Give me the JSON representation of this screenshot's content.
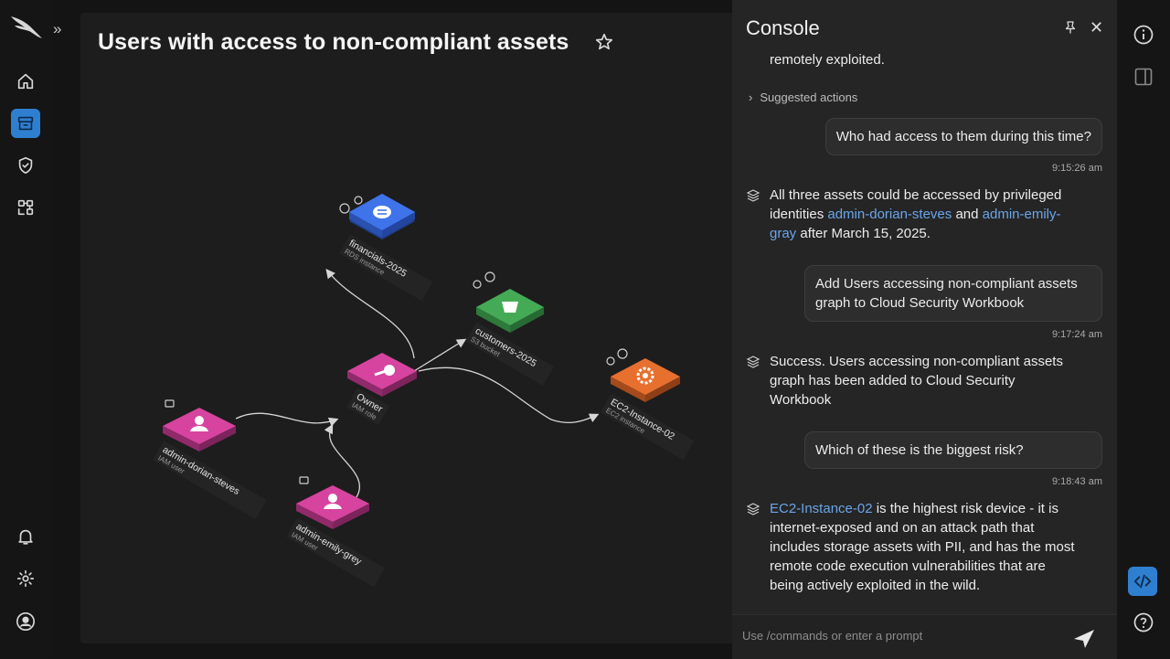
{
  "app": {
    "name": "CrowdStrike Falcon"
  },
  "colors": {
    "accent": "#2f7fd1",
    "link": "#6aa5ea",
    "node_blue": "#3a6be0",
    "node_green": "#3fa14e",
    "node_orange": "#e46a2a",
    "node_pink": "#d03e9b"
  },
  "left_rail": {
    "items": [
      {
        "icon": "home-icon"
      },
      {
        "icon": "archive-box-icon",
        "active": true
      },
      {
        "icon": "shield-check-icon"
      },
      {
        "icon": "connected-graph-icon"
      },
      {
        "icon": "bell-icon"
      },
      {
        "icon": "gear-icon"
      },
      {
        "icon": "user-avatar-icon"
      }
    ]
  },
  "page": {
    "title": "Users with access to non-compliant assets"
  },
  "graph": {
    "nodes": [
      {
        "id": "financials",
        "name": "financials-2025",
        "type": "RDS instance",
        "color": "#3a6be0"
      },
      {
        "id": "customers",
        "name": "customers-2025",
        "type": "S3 bucket",
        "color": "#3fa14e"
      },
      {
        "id": "ec2",
        "name": "EC2-Instance-02",
        "type": "EC2 instance",
        "color": "#e46a2a"
      },
      {
        "id": "owner",
        "name": "Owner",
        "type": "IAM role",
        "color": "#d03e9b"
      },
      {
        "id": "dorian",
        "name": "admin-dorian-steves",
        "type": "IAM user",
        "color": "#d03e9b"
      },
      {
        "id": "emily",
        "name": "admin-emily-grey",
        "type": "IAM user",
        "color": "#d03e9b"
      }
    ]
  },
  "console": {
    "title": "Console",
    "messages": [
      {
        "role": "assistant",
        "text": "remotely exploited."
      },
      {
        "role": "ui",
        "text": "Suggested actions"
      },
      {
        "role": "user",
        "text": "Who had access to them during this time?",
        "time": "9:15:26 am"
      },
      {
        "role": "assistant",
        "parts": [
          "All three assets could be accessed by privileged identities ",
          "admin-dorian-steves",
          " and ",
          "admin-emily-gray",
          " after March 15, 2025."
        ]
      },
      {
        "role": "user",
        "text": "Add Users accessing non-compliant assets graph to Cloud Security Workbook",
        "time": "9:17:24 am"
      },
      {
        "role": "assistant",
        "text": "Success. Users accessing non-compliant assets graph has been added to Cloud Security Workbook"
      },
      {
        "role": "user",
        "text": "Which of these is the biggest risk?",
        "time": "9:18:43 am"
      },
      {
        "role": "assistant",
        "parts": [
          "EC2-Instance-02",
          " is the highest risk device - it is internet-exposed and on an attack path that includes storage assets with PII, and has the most remote code execution vulnerabilities that are being actively exploited in the wild."
        ]
      }
    ],
    "prompt_placeholder": "Use /commands or enter a prompt"
  }
}
